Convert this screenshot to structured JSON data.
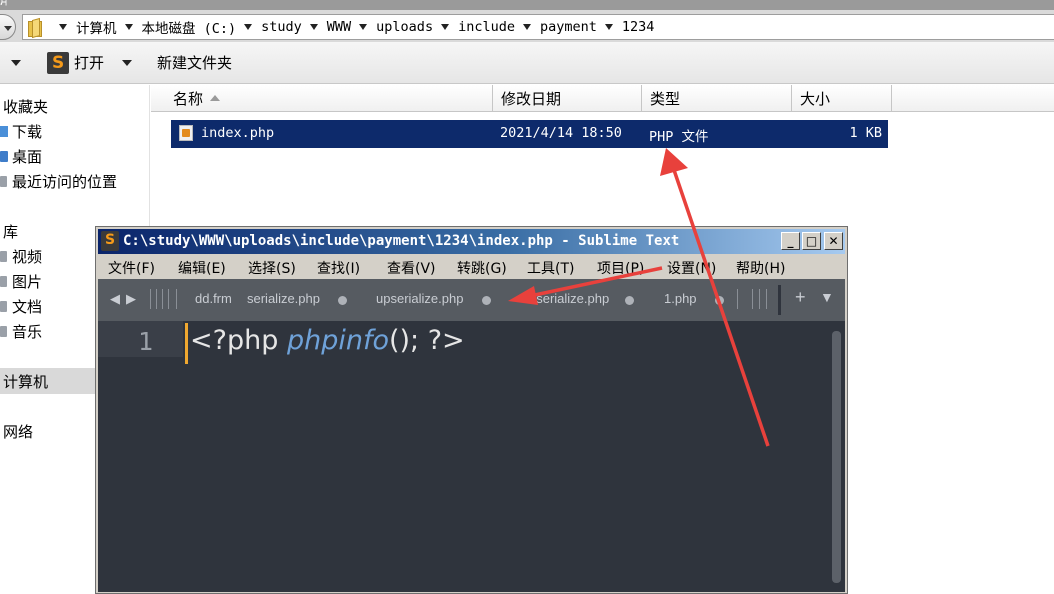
{
  "explorer": {
    "address_crumbs": [
      "计算机",
      "本地磁盘 (C:)",
      "study",
      "WWW",
      "uploads",
      "include",
      "payment",
      "1234"
    ],
    "toolbar": {
      "open_label": "打开",
      "new_folder_label": "新建文件夹"
    },
    "sidebar": {
      "favorites": "收藏夹",
      "fav_items": [
        "下载",
        "桌面",
        "最近访问的位置"
      ],
      "library": "库",
      "lib_items": [
        "视频",
        "图片",
        "文档",
        "音乐"
      ],
      "computer": "计算机",
      "network": "网络"
    },
    "columns": {
      "name": "名称",
      "modified": "修改日期",
      "type": "类型",
      "size": "大小"
    },
    "files": [
      {
        "name": "index.php",
        "modified": "2021/4/14 18:50",
        "type": "PHP 文件",
        "size": "1 KB"
      }
    ]
  },
  "sublime": {
    "title": "C:\\study\\WWW\\uploads\\include\\payment\\1234\\index.php - Sublime Text",
    "menu": [
      "文件(F)",
      "编辑(E)",
      "选择(S)",
      "查找(I)",
      "查看(V)",
      "转跳(G)",
      "工具(T)",
      "项目(P)",
      "设置(N)",
      "帮助(H)"
    ],
    "tabs": [
      "dd.frm",
      "serialize.php",
      "upserialize.php",
      "nserialize.php",
      "1.php"
    ],
    "line_number": "1",
    "code_open": "<?php ",
    "code_fn": "phpinfo",
    "code_close": "(); ?>"
  },
  "colors": {
    "selection": "#0d2a6b",
    "sublime_bg": "#2f343d",
    "annotation_arrow": "#e8413c"
  }
}
